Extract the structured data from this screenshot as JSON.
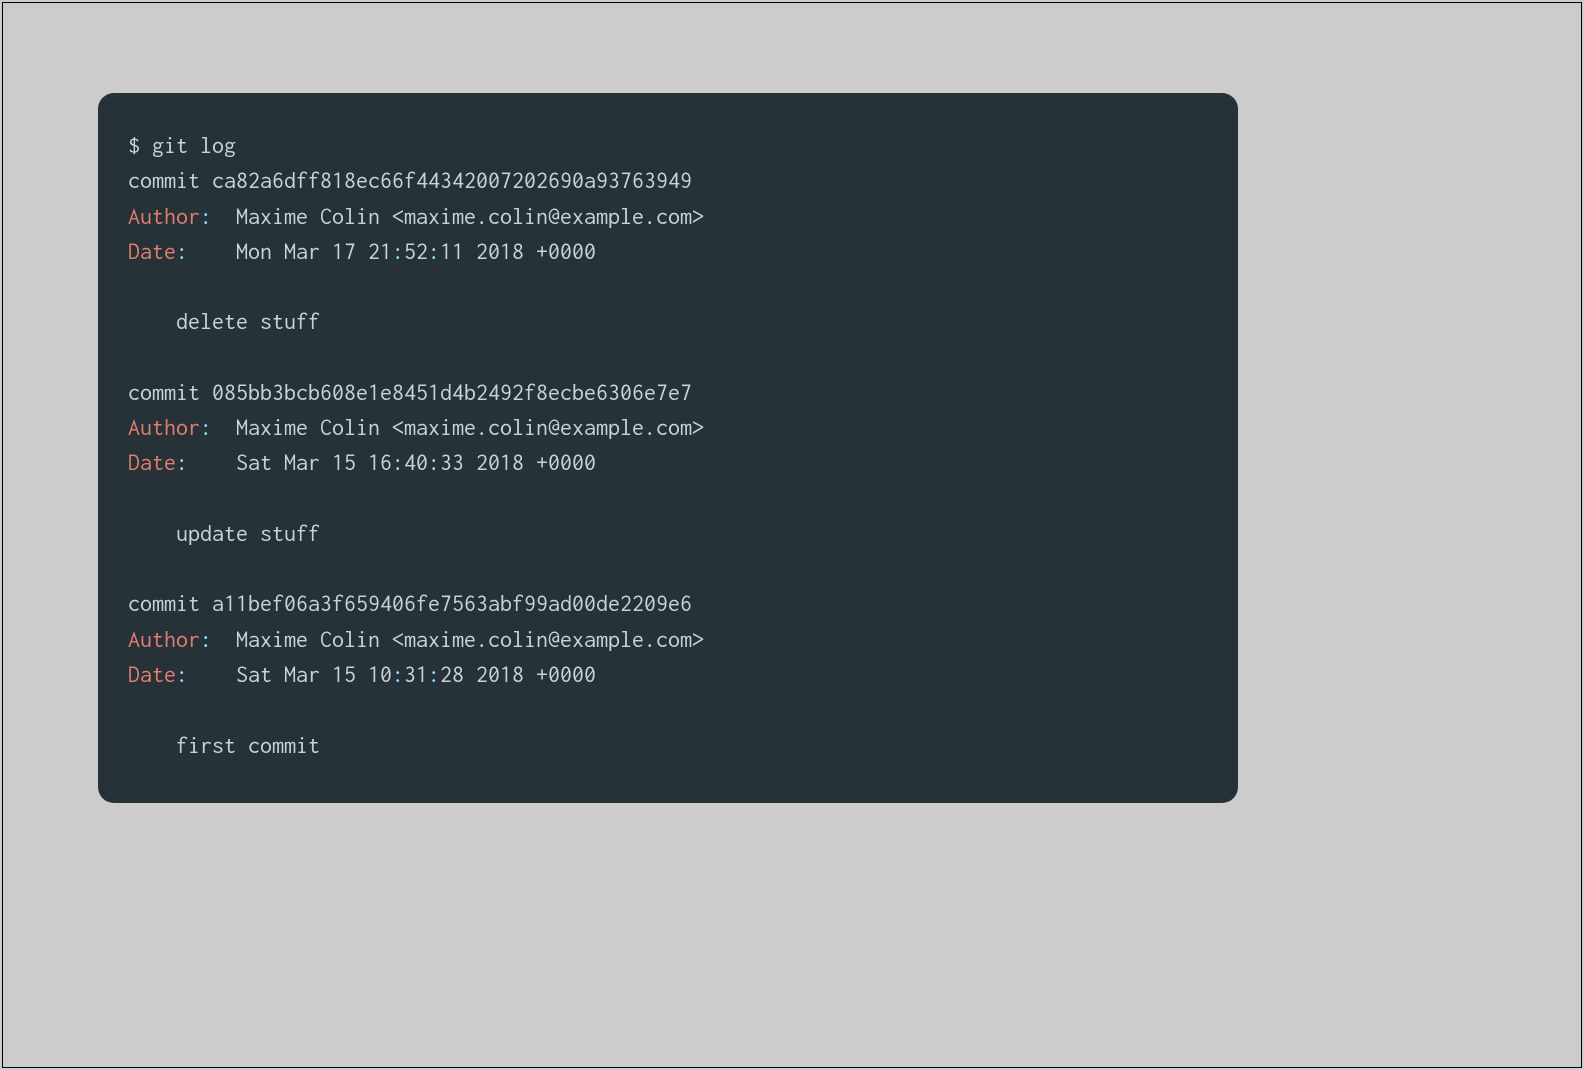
{
  "terminal": {
    "prompt": "$ git log",
    "commits": [
      {
        "commit_label": "commit",
        "hash": "ca82a6dff818ec66f44342007202690a93763949",
        "author_label": "Author",
        "author_value": "  Maxime Colin <maxime.colin@example.com>",
        "date_label": "Date",
        "date_prefix": "    Mon Mar 17 21",
        "date_minutes": "52",
        "date_seconds": "11 2018 +0000",
        "message": "    delete stuff"
      },
      {
        "commit_label": "commit",
        "hash": "085bb3bcb608e1e8451d4b2492f8ecbe6306e7e7",
        "author_label": "Author",
        "author_value": "  Maxime Colin <maxime.colin@example.com>",
        "date_label": "Date",
        "date_prefix": "    Sat Mar 15 16",
        "date_minutes": "40",
        "date_seconds": "33 2018 +0000",
        "message": "    update stuff"
      },
      {
        "commit_label": "commit",
        "hash": "a11bef06a3f659406fe7563abf99ad00de2209e6",
        "author_label": "Author",
        "author_value": "  Maxime Colin <maxime.colin@example.com>",
        "date_label": "Date",
        "date_prefix": "    Sat Mar 15 10",
        "date_minutes": "31",
        "date_seconds": "28 2018 +0000",
        "message": "    first commit"
      }
    ],
    "colon": ":",
    "space": " "
  }
}
